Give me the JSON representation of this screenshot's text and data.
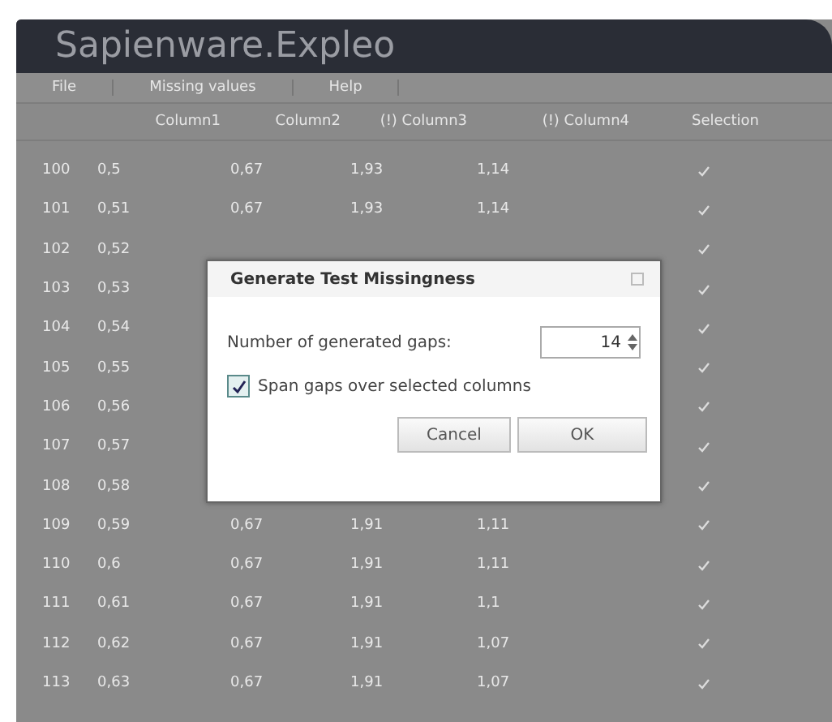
{
  "window": {
    "title": "Sapienware.Expleo"
  },
  "menu": [
    "File",
    "Missing values",
    "Help"
  ],
  "table": {
    "columns": [
      "Column1",
      "Column2",
      "(!) Column3",
      "(!) Column4",
      "Selection"
    ],
    "rows": [
      {
        "index": "100",
        "cells": [
          "0,5",
          "0,67",
          "1,93",
          "1,14"
        ],
        "checked": true
      },
      {
        "index": "101",
        "cells": [
          "0,51",
          "0,67",
          "1,93",
          "1,14"
        ],
        "checked": true
      },
      {
        "index": "102",
        "cells": [
          "0,52"
        ],
        "checked": true
      },
      {
        "index": "103",
        "cells": [
          "0,53"
        ],
        "checked": true
      },
      {
        "index": "104",
        "cells": [
          "0,54"
        ],
        "checked": true
      },
      {
        "index": "105",
        "cells": [
          "0,55"
        ],
        "checked": true
      },
      {
        "index": "106",
        "cells": [
          "0,56"
        ],
        "checked": true
      },
      {
        "index": "107",
        "cells": [
          "0,57"
        ],
        "checked": true
      },
      {
        "index": "108",
        "cells": [
          "0,58"
        ],
        "checked": true
      },
      {
        "index": "109",
        "cells": [
          "0,59",
          "0,67",
          "1,91",
          "1,11"
        ],
        "checked": true
      },
      {
        "index": "110",
        "cells": [
          "0,6",
          "0,67",
          "1,91",
          "1,11"
        ],
        "checked": true
      },
      {
        "index": "111",
        "cells": [
          "0,61",
          "0,67",
          "1,91",
          "1,1"
        ],
        "checked": true
      },
      {
        "index": "112",
        "cells": [
          "0,62",
          "0,67",
          "1,91",
          "1,07"
        ],
        "checked": true
      },
      {
        "index": "113",
        "cells": [
          "0,63",
          "0,67",
          "1,91",
          "1,07"
        ],
        "checked": true
      }
    ]
  },
  "dialog": {
    "title": "Generate Test Missingness",
    "gaps_label": "Number of generated gaps:",
    "gaps_value": "14",
    "span_label": "Span gaps over selected columns",
    "span_checked": true,
    "buttons": [
      "Cancel",
      "OK"
    ]
  }
}
